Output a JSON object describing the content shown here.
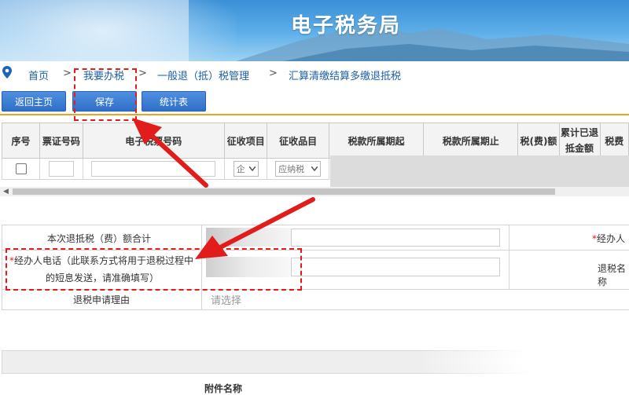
{
  "banner": {
    "title": "电子税务局"
  },
  "breadcrumb": {
    "home": "首页",
    "sep": ">",
    "level1": "我要办税",
    "level2": "一般退（抵）税管理",
    "level3": "汇算清缴结算多缴退抵税"
  },
  "toolbar": {
    "back": "返回主页",
    "save": "保存",
    "stats": "统计表"
  },
  "table": {
    "headers": [
      "序号",
      "票证号码",
      "电子税票号码",
      "征收项目",
      "征收品目",
      "税款所属期起",
      "税款所属期止",
      "税(费)额",
      "累计已退抵金额",
      "税费"
    ],
    "row": {
      "item_select": "企",
      "category_select": "应纳税"
    }
  },
  "form": {
    "total_label": "本次退抵税（费）额合计",
    "agent_label": "经办人",
    "phone_label_line1": "经办人电话（此联系方式将用于退税过程中",
    "phone_label_line2": "的短息发送，请准确填写）",
    "refund_name_label": "退税名称",
    "reason_label": "退税申请理由",
    "reason_placeholder": "请选择",
    "required_mark": "*"
  },
  "attachments": {
    "name_header": "附件名称"
  },
  "colors": {
    "banner": "#3a8fd6",
    "button": "#2f6fc9",
    "accent_line": "#f0a020",
    "annotation": "#e21b1b",
    "link": "#1a5fa8"
  }
}
